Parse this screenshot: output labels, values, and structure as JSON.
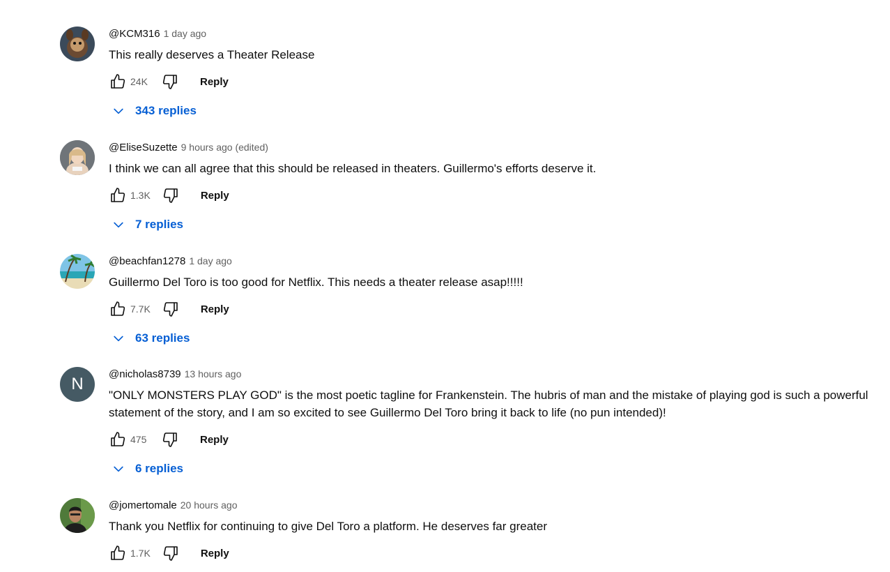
{
  "comments": [
    {
      "author": "@KCM316",
      "time": "1 day ago",
      "text": "This really deserves a Theater Release",
      "likes": "24K",
      "reply_label": "Reply",
      "replies_label": "343 replies"
    },
    {
      "author": "@EliseSuzette",
      "time": "9 hours ago (edited)",
      "text": "I think we can all agree that this should be released in theaters. Guillermo's efforts deserve it.",
      "likes": "1.3K",
      "reply_label": "Reply",
      "replies_label": "7 replies"
    },
    {
      "author": "@beachfan1278",
      "time": "1 day ago",
      "text": "Guillermo Del Toro is too good for Netflix. This needs a theater release asap!!!!!",
      "likes": "7.7K",
      "reply_label": "Reply",
      "replies_label": "63 replies"
    },
    {
      "author": "@nicholas8739",
      "time": "13 hours ago",
      "text": "\"ONLY MONSTERS PLAY GOD\" is the most poetic tagline for Frankenstein. The hubris of man and the mistake of playing god is such a powerful statement of the story, and I am so excited to see Guillermo Del Toro bring it back to life (no pun intended)!",
      "likes": "475",
      "reply_label": "Reply",
      "replies_label": "6 replies",
      "avatar_letter": "N"
    },
    {
      "author": "@jomertomale",
      "time": "20 hours ago",
      "text": "Thank you Netflix for continuing to give Del Toro a platform. He deserves far greater",
      "likes": "1.7K",
      "reply_label": "Reply"
    }
  ],
  "icons": {
    "like": "thumbs-up-icon",
    "dislike": "thumbs-down-icon",
    "expand": "chevron-down-icon"
  },
  "colors": {
    "link_blue": "#065fd4",
    "meta_gray": "#606060",
    "text": "#0f0f0f",
    "letter_avatar_bg": "#455a64"
  }
}
